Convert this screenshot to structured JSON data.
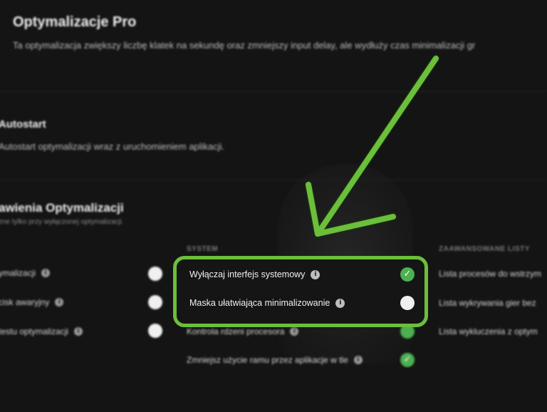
{
  "header": {
    "title": "Optymalizacje Pro",
    "description": "Ta optymalizacja zwiększy liczbę klatek na sekundę oraz zmniejszy input delay, ale wydłuży czas minimalizacji gr"
  },
  "autostart": {
    "title": "Autostart",
    "description": "Autostart optymalizacji wraz z uruchomieniem aplikacji."
  },
  "settings": {
    "title": "awienia Optymalizacji",
    "subtitle": "zne tylko przy wyłączonej optymalizacji.",
    "left_items": [
      {
        "label": "ymalizacji",
        "on": false
      },
      {
        "label": "cisk awaryjny",
        "on": false
      },
      {
        "label": "testu optymalizacji",
        "on": false
      }
    ],
    "system_header": "SYSTEM",
    "system_items": [
      {
        "label": "Wyłączaj interfejs systemowy",
        "on": true
      },
      {
        "label": "Maska ułatwiająca minimalizowanie",
        "on": false
      },
      {
        "label": "Kontrola rdzeni procesora",
        "on": true
      },
      {
        "label": "Zmniejsz użycie ramu przez aplikacje w tle",
        "on": true
      }
    ],
    "advanced_header": "ZAAWANSOWANE LISTY",
    "advanced_items": [
      {
        "label": "Lista procesów do wstrzym"
      },
      {
        "label": "Lista wykrywania gier bez"
      },
      {
        "label": "Lista wykluczenia z optym"
      }
    ]
  },
  "colors": {
    "background": "#141414",
    "accent_green": "#4caf50",
    "highlight_green": "#6bbf3a"
  },
  "icons": {
    "info": "info-icon",
    "check": "checkmark-icon",
    "arrow": "arrow-down-left-icon"
  }
}
